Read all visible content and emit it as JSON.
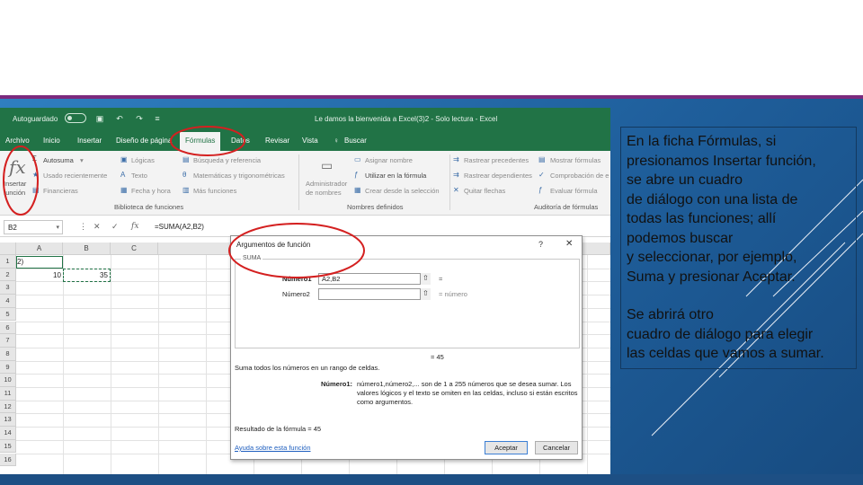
{
  "excel": {
    "quick_access": {
      "autosave_label": "Autoguardado"
    },
    "window_title": "Le damos la bienvenida a Excel(3)2  -  Solo lectura  -  Excel",
    "tabs": [
      "Archivo",
      "Inicio",
      "Insertar",
      "Diseño de página",
      "Fórmulas",
      "Datos",
      "Revisar",
      "Vista"
    ],
    "active_tab": "Fórmulas",
    "search_label": "Buscar",
    "ribbon": {
      "insert_function": "Insertar\nfunción",
      "autosum": "Autosuma",
      "recent": "Usado recientemente",
      "financial": "Financieras",
      "logical": "Lógicas",
      "text": "Texto",
      "datetime": "Fecha y hora",
      "lookup": "Búsqueda y referencia",
      "math": "Matemáticas y trigonométricas",
      "more": "Más funciones",
      "library_group": "Biblioteca de funciones",
      "name_manager": "Administrador\nde nombres",
      "define_name": "Asignar nombre",
      "use_in_formula": "Utilizar en la fórmula",
      "create_from_selection": "Crear desde la selección",
      "names_group": "Nombres definidos",
      "trace_precedents": "Rastrear precedentes",
      "trace_dependents": "Rastrear dependientes",
      "remove_arrows": "Quitar flechas",
      "show_formulas": "Mostrar fórmulas",
      "error_checking": "Comprobación de e",
      "evaluate_formula": "Evaluar fórmula",
      "audit_group": "Auditoría de fórmulas"
    },
    "name_box": "B2",
    "formula": "=SUMA(A2,B2)",
    "columns": [
      "A",
      "B",
      "C"
    ],
    "rows": [
      "1",
      "2",
      "3",
      "4",
      "5",
      "6",
      "7",
      "8",
      "9",
      "10",
      "11",
      "12",
      "13",
      "14",
      "15",
      "16"
    ],
    "cells": {
      "a1": "2)",
      "a2": "10",
      "b2": "35"
    }
  },
  "dialog": {
    "title": "Argumentos de función",
    "help": "?",
    "close": "✕",
    "function_name": "SUMA",
    "arg1_label": "Número1",
    "arg1_value": "A2,B2",
    "arg1_result": "=",
    "arg2_label": "Número2",
    "arg2_value": "",
    "arg2_result": "=  número",
    "total": "=    45",
    "description": "Suma todos los números en un rango de celdas.",
    "param_name": "Número1:",
    "param_desc1": "número1,número2,... son de 1 a 255 números que se desea sumar. Los",
    "param_desc2": "valores lógicos y el texto se omiten en las celdas, incluso si están escritos",
    "param_desc3": "como argumentos.",
    "result_line": "Resultado de la fórmula =   45",
    "help_link": "Ayuda sobre esta función",
    "ok_button": "Aceptar",
    "cancel_button": "Cancelar"
  },
  "slide_text": {
    "paragraph1": "En la ficha Fórmulas, si\npresionamos Insertar función,\nse abre un cuadro\nde diálogo con una lista de\ntodas las funciones; allí\npodemos buscar\ny seleccionar, por ejemplo,\nSuma y presionar Aceptar.",
    "paragraph2": "Se abrirá otro\ncuadro de diálogo para elegir\nlas celdas que vamos a sumar."
  },
  "colors": {
    "excel_green": "#217346",
    "slide_blue": "#1f5f9c",
    "annotation_red": "#d42020",
    "accent_purple": "#7b2a7e"
  }
}
